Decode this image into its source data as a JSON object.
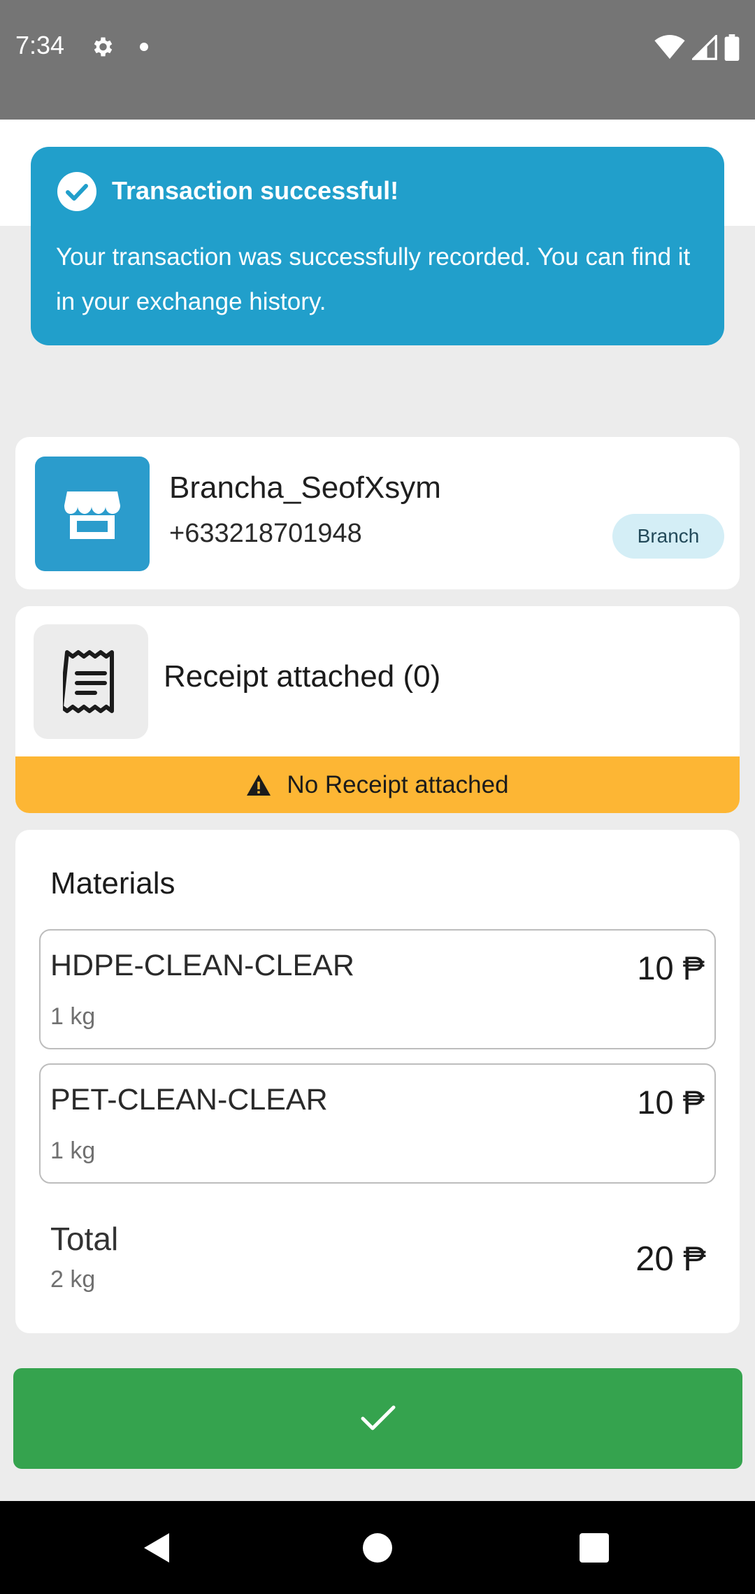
{
  "status_bar": {
    "time": "7:34",
    "icons": [
      "gear-icon",
      "notification-dot-icon",
      "wifi-icon",
      "signal-icon",
      "battery-icon"
    ]
  },
  "toast": {
    "icon": "check-circle-icon",
    "title": "Transaction successful!",
    "message": "Your transaction was successfully recorded. You can find it in your exchange history.",
    "color": "#219fcb"
  },
  "branch": {
    "icon": "store-icon",
    "name": "Brancha_SeofXsym",
    "phone": "+633218701948",
    "badge": "Branch"
  },
  "receipt": {
    "icon": "receipt-icon",
    "title": "Receipt attached (0)",
    "warning_icon": "warning-icon",
    "warning": "No Receipt attached",
    "warning_color": "#fdb634"
  },
  "materials": {
    "title": "Materials",
    "items": [
      {
        "name": "HDPE-CLEAN-CLEAR",
        "weight": "1 kg",
        "price": "10 ₱"
      },
      {
        "name": "PET-CLEAN-CLEAR",
        "weight": "1 kg",
        "price": "10 ₱"
      }
    ],
    "total_label": "Total",
    "total_weight": "2 kg",
    "total_price": "20 ₱"
  },
  "confirm_button": {
    "icon": "checkmark-icon",
    "color": "#35a34e"
  },
  "nav_bar": {
    "icons": [
      "back-icon",
      "home-icon",
      "recents-icon"
    ]
  }
}
